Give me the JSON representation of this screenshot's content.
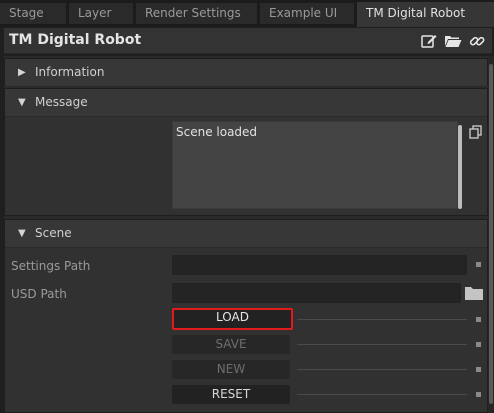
{
  "tabs": [
    {
      "label": "Stage",
      "active": false
    },
    {
      "label": "Layer",
      "active": false
    },
    {
      "label": "Render Settings",
      "active": false
    },
    {
      "label": "Example UI",
      "active": false
    },
    {
      "label": "TM Digital Robot",
      "active": true
    }
  ],
  "window": {
    "title": "TM Digital Robot",
    "icons": [
      "edit-icon",
      "folder-open-icon",
      "link-icon"
    ]
  },
  "sections": {
    "information": {
      "label": "Information",
      "collapsed": true
    },
    "message": {
      "label": "Message",
      "collapsed": false,
      "text": "Scene loaded"
    },
    "scene": {
      "label": "Scene",
      "collapsed": false,
      "settings_path": {
        "label": "Settings Path",
        "value": ""
      },
      "usd_path": {
        "label": "USD Path",
        "value": ""
      },
      "buttons": {
        "load": "LOAD",
        "save": "SAVE",
        "new": "NEW",
        "reset": "RESET"
      }
    }
  },
  "colors": {
    "highlight": "#e01b1b",
    "panel": "#313131",
    "header": "#373737"
  }
}
